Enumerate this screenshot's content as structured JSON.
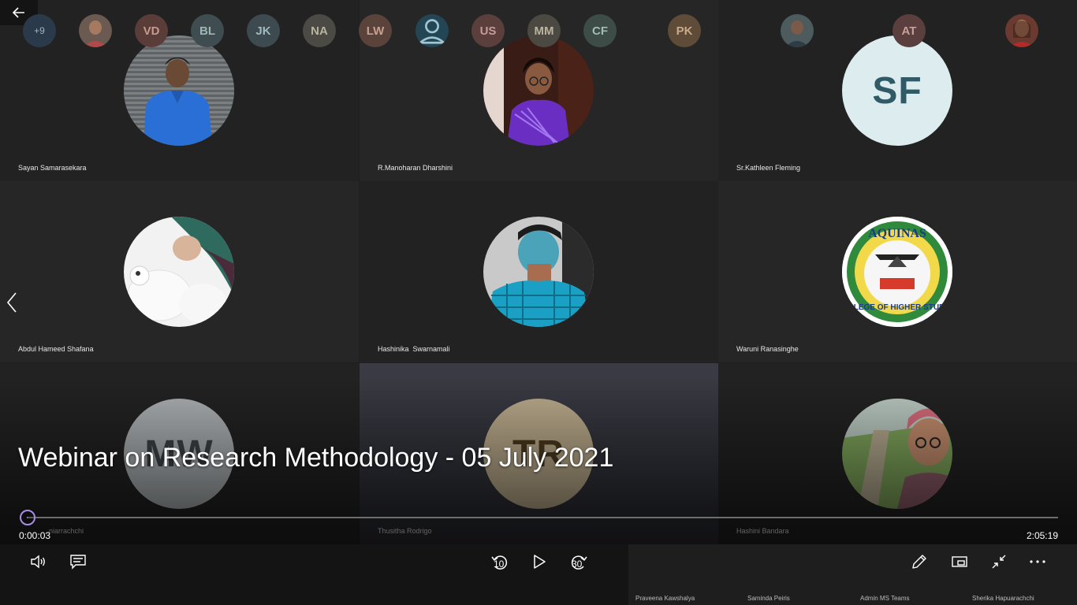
{
  "video": {
    "title": "Webinar on Research Methodology - 05 July 2021",
    "current_time": "0:00:03",
    "total_time": "2:05:19",
    "progress": 0.0004,
    "skip_back_seconds": "10",
    "skip_forward_seconds": "30"
  },
  "tiles": [
    {
      "name": "Sayan Samarasekara"
    },
    {
      "name": "R.Manoharan Dharshini"
    },
    {
      "name": "Sr.Kathleen Fleming",
      "initials": "SF"
    },
    {
      "name": "Abdul Hameed Shafana"
    },
    {
      "name": "Hashinika  Swarnamali"
    },
    {
      "name": "Waruni Ranasinghe",
      "logo_text_top": "AQUINAS",
      "logo_text_bottom": "COLLEGE OF HIGHER STUDIES"
    },
    {
      "name": "niarrachchi",
      "initials": "MW"
    },
    {
      "name": "Thusitha Rodrigo",
      "initials": "TR"
    },
    {
      "name": "Hashini Bandara"
    }
  ],
  "strip": {
    "overflow_count": "+9",
    "participants": [
      {
        "initials": "VD"
      },
      {
        "initials": "BL"
      },
      {
        "initials": "JK"
      },
      {
        "initials": "NA"
      },
      {
        "initials": "LW"
      },
      {
        "initials": "US"
      },
      {
        "initials": "MM"
      },
      {
        "initials": "CF"
      },
      {
        "initials": "PK",
        "name": "Praveena Kawshalya"
      },
      {
        "name": "Saminda Peiris"
      },
      {
        "initials": "AT",
        "name": "Admin MS Teams"
      },
      {
        "name": "Sherika Hapuarachchi"
      }
    ]
  },
  "colors": {
    "accent": "#a98be8",
    "sf_avatar_bg": "#dcecef",
    "sf_avatar_fg": "#2f5a66"
  },
  "icons": [
    "back-arrow-icon",
    "chevron-left-icon",
    "volume-icon",
    "captions-icon",
    "rewind-10-icon",
    "play-icon",
    "forward-30-icon",
    "pen-icon",
    "picture-in-picture-icon",
    "exit-fullscreen-icon",
    "more-options-icon"
  ]
}
